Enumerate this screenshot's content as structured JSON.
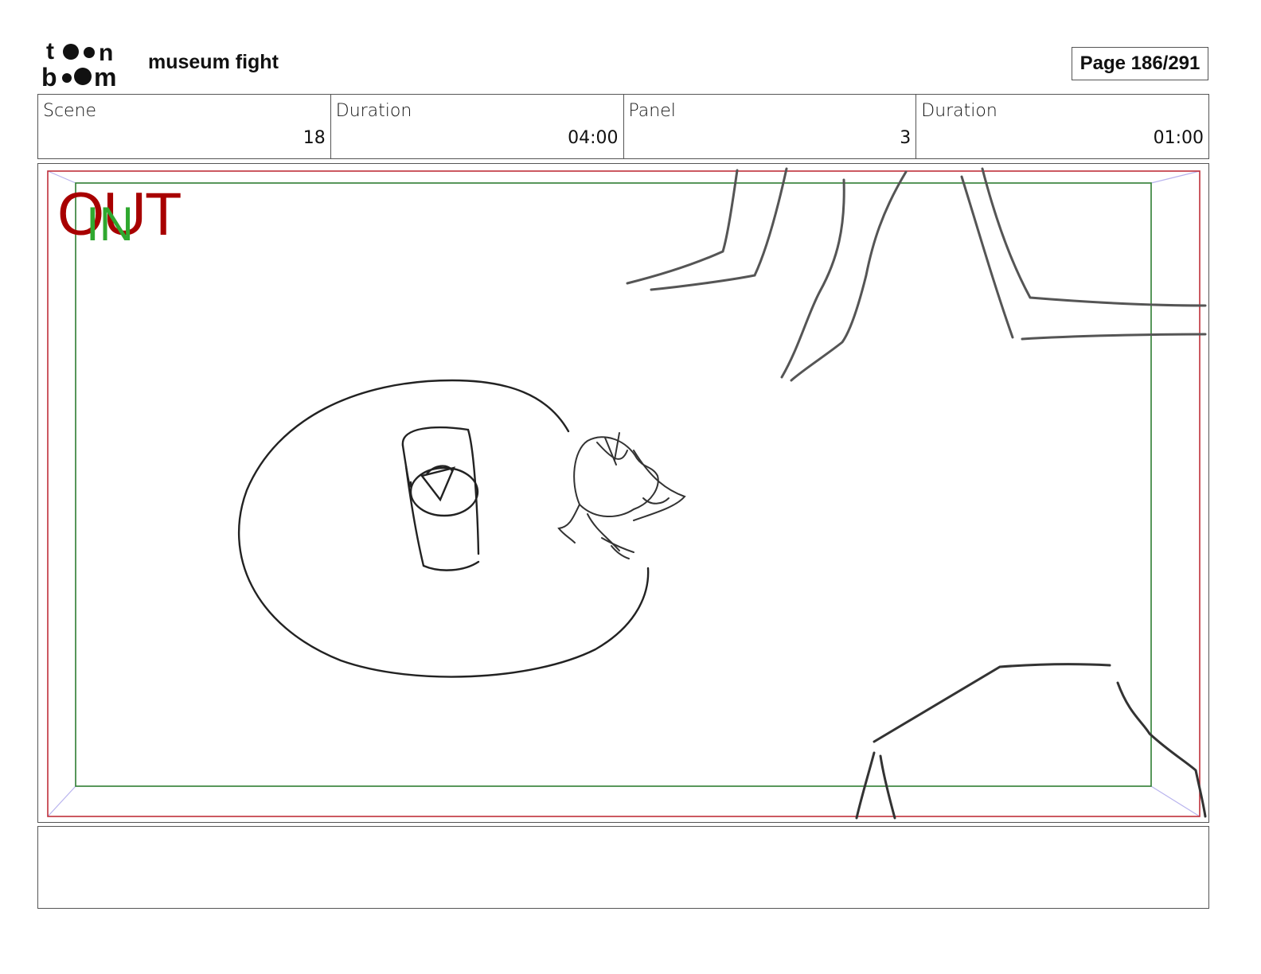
{
  "header": {
    "logo_text": "toon boom",
    "project_title": "museum fight",
    "page_label": "Page 186/291"
  },
  "info": [
    {
      "label": "Scene",
      "value": "18"
    },
    {
      "label": "Duration",
      "value": "04:00"
    },
    {
      "label": "Panel",
      "value": "3"
    },
    {
      "label": "Duration",
      "value": "01:00"
    }
  ],
  "panel": {
    "out_label": "OUT",
    "in_label": "IN",
    "colors": {
      "out_frame": "#c0303a",
      "in_frame": "#2e7d32",
      "sketch": "#222222"
    }
  },
  "notes": {
    "text": ""
  }
}
